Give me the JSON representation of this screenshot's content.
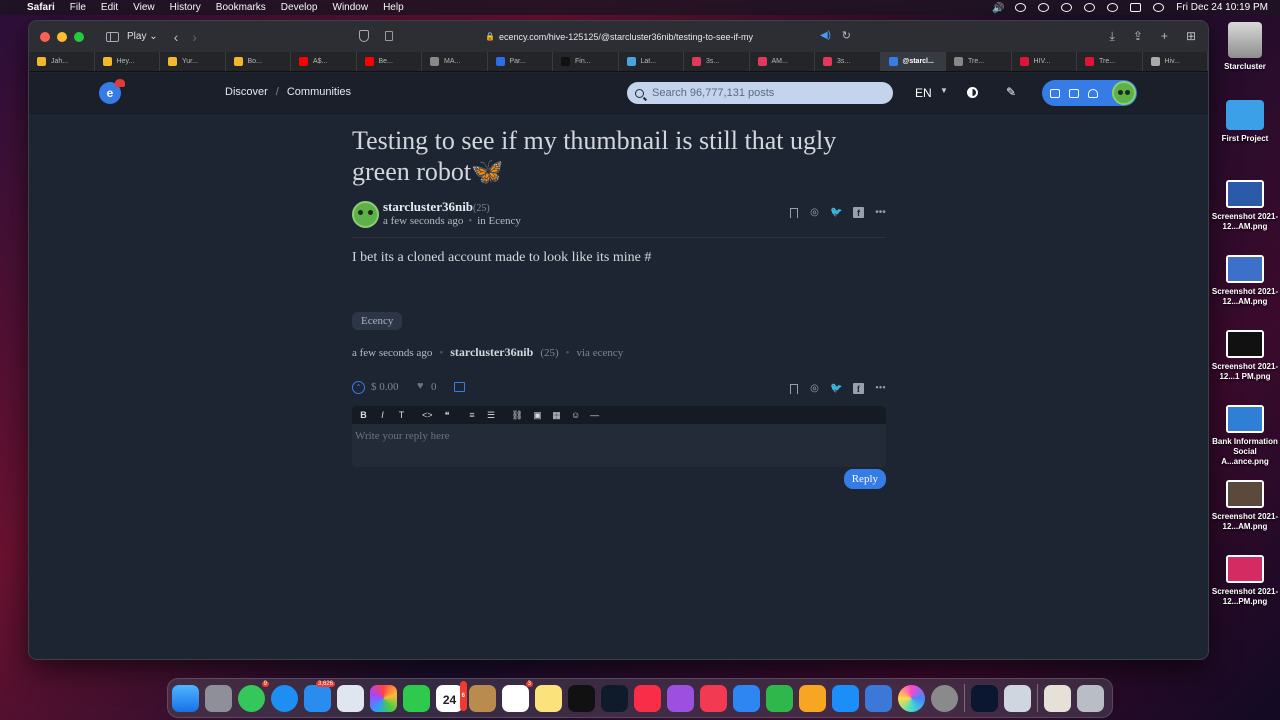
{
  "menubar": {
    "app_name": "Safari",
    "menus": [
      "File",
      "Edit",
      "View",
      "History",
      "Bookmarks",
      "Develop",
      "Window",
      "Help"
    ],
    "datetime": "Fri Dec 24  10:19 PM"
  },
  "browser": {
    "play_label": "Play",
    "url": "ecency.com/hive-125125/@starcluster36nib/testing-to-see-if-my",
    "tabs": [
      {
        "label": "Jah...",
        "color": "#f2b72a",
        "active": false
      },
      {
        "label": "Hey...",
        "color": "#f2b72a",
        "active": false
      },
      {
        "label": "Yur...",
        "color": "#f2b72a",
        "active": false
      },
      {
        "label": "Bo...",
        "color": "#f2b72a",
        "active": false
      },
      {
        "label": "A$...",
        "color": "#ff0000",
        "active": false
      },
      {
        "label": "Be...",
        "color": "#ff0000",
        "active": false
      },
      {
        "label": "MA...",
        "color": "#888888",
        "active": false
      },
      {
        "label": "Par...",
        "color": "#2b6fe6",
        "active": false
      },
      {
        "label": "Fin...",
        "color": "#111111",
        "active": false
      },
      {
        "label": "Lat...",
        "color": "#4aa3df",
        "active": false
      },
      {
        "label": "3s...",
        "color": "#e0395b",
        "active": false
      },
      {
        "label": "AM...",
        "color": "#e0395b",
        "active": false
      },
      {
        "label": "3s...",
        "color": "#e0395b",
        "active": false
      },
      {
        "label": "@starcl...",
        "color": "#357ce6",
        "active": true
      },
      {
        "label": "Tre...",
        "color": "#888888",
        "active": false
      },
      {
        "label": "HIV...",
        "color": "#e31337",
        "active": false
      },
      {
        "label": "Tre...",
        "color": "#e31337",
        "active": false
      },
      {
        "label": "Hiv...",
        "color": "#aaaaaa",
        "active": false
      }
    ]
  },
  "site": {
    "nav": {
      "discover": "Discover",
      "separator": "/",
      "communities": "Communities",
      "search_placeholder": "Search 96,777,131 posts",
      "language": "EN"
    },
    "post": {
      "title": "Testing to see if my thumbnail is still that ugly green robot",
      "title_emoji": "🦋",
      "author": "starcluster36nib",
      "reputation": "(25)",
      "time": "a few seconds ago",
      "community_prefix": "in",
      "community": "Ecency",
      "body": "I bet its a cloned account made to look like its mine #",
      "tag": "Ecency",
      "footer_time": "a few seconds ago",
      "footer_author": "starcluster36nib",
      "footer_rep": "(25)",
      "via_label": "via",
      "via_app": "ecency",
      "payout": "$ 0.00",
      "votes": "0"
    },
    "editor": {
      "placeholder": "Write your reply here",
      "reply_label": "Reply"
    }
  },
  "desktop": {
    "icons": [
      {
        "label": "Starcluster",
        "kind": "drive"
      },
      {
        "label": "First Project",
        "kind": "folder"
      },
      {
        "label": "Screenshot 2021-12...AM.png",
        "kind": "shot"
      },
      {
        "label": "Screenshot 2021-12...AM.png",
        "kind": "shot"
      },
      {
        "label": "Screenshot 2021-12...1 PM.png",
        "kind": "shot"
      },
      {
        "label": "Bank Information Social A...ance.png",
        "kind": "shot"
      },
      {
        "label": "Screenshot 2021-12...AM.png",
        "kind": "shot"
      },
      {
        "label": "Screenshot 2021-12...PM.png",
        "kind": "shot"
      }
    ]
  },
  "dock": {
    "badges": {
      "messages": "9",
      "mail": "3,626",
      "calendar": "6",
      "reminders": "3"
    },
    "calendar_month": "DEC",
    "calendar_day": "24"
  }
}
